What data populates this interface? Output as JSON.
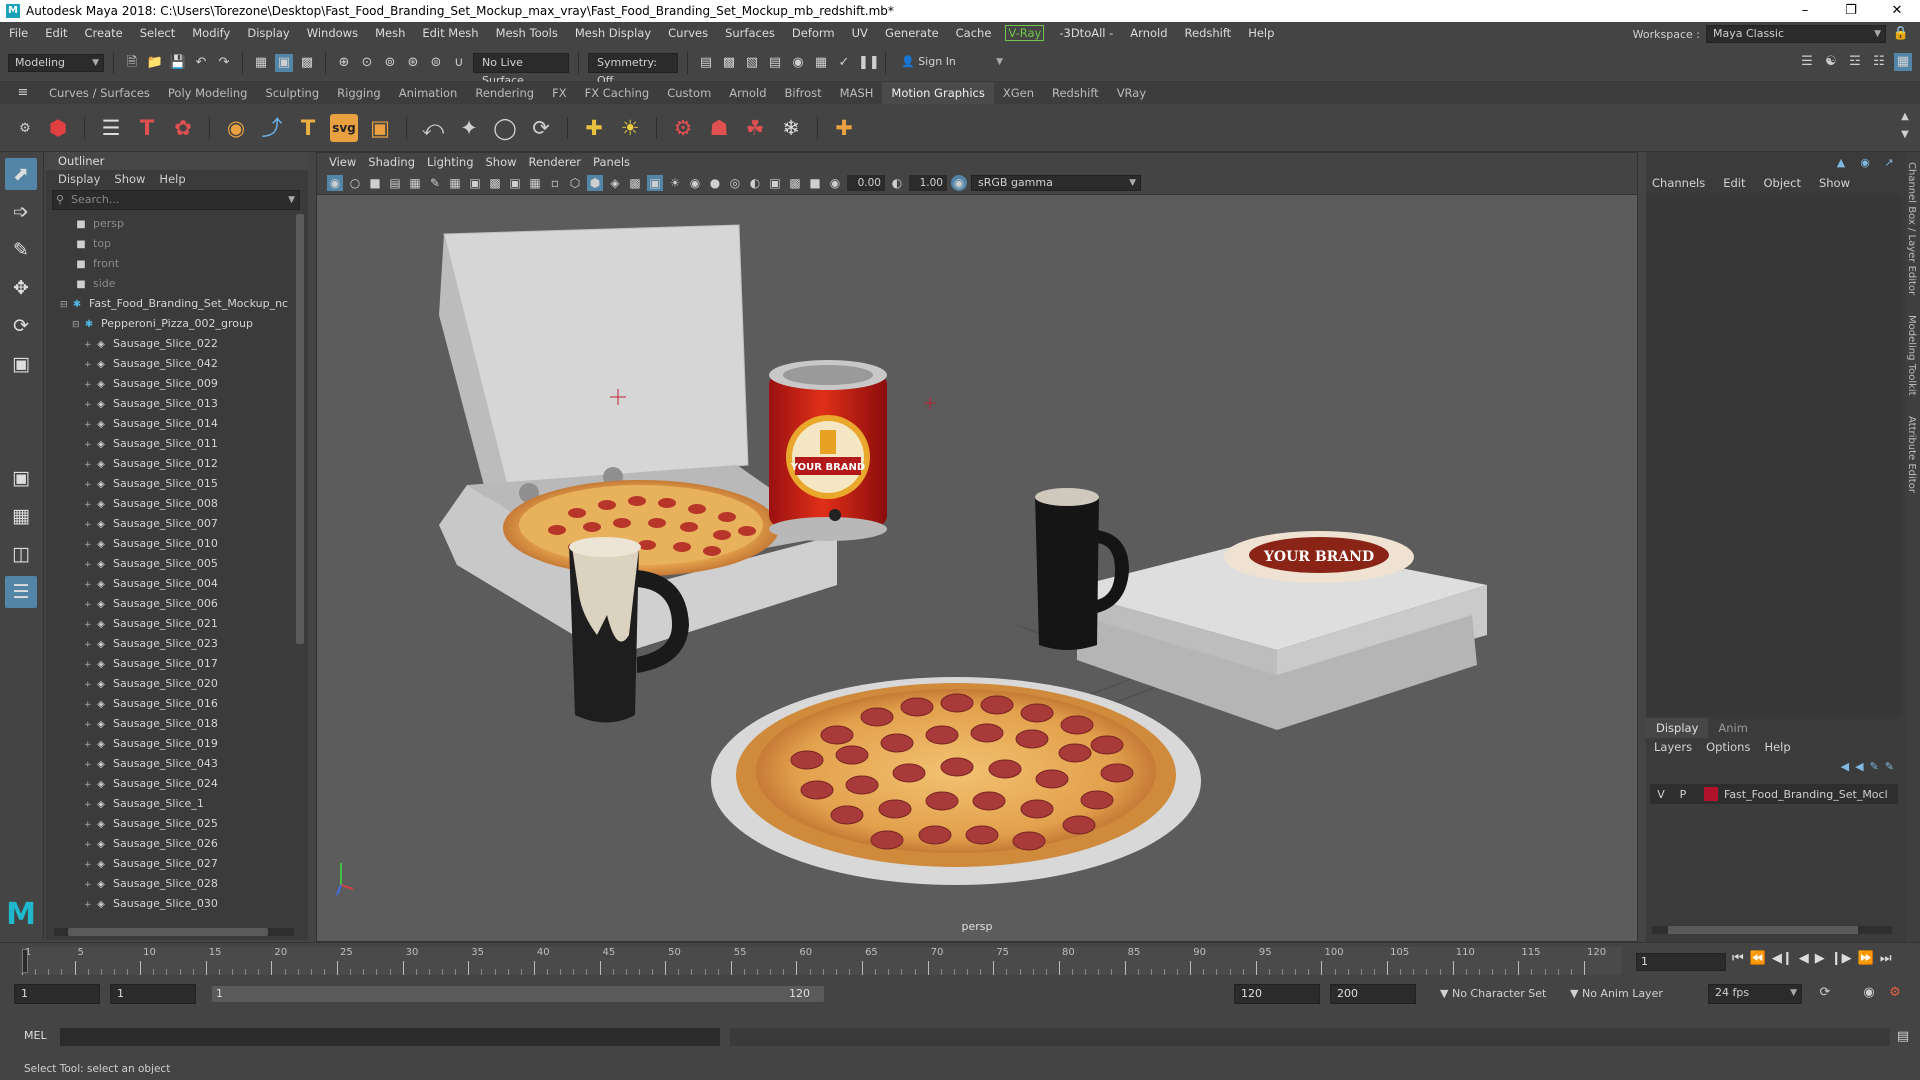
{
  "window": {
    "title": "Autodesk Maya 2018: C:\\Users\\Torezone\\Desktop\\Fast_Food_Branding_Set_Mockup_max_vray\\Fast_Food_Branding_Set_Mockup_mb_redshift.mb*",
    "app_icon": "M"
  },
  "menubar": {
    "items": [
      "File",
      "Edit",
      "Create",
      "Select",
      "Modify",
      "Display",
      "Windows",
      "Mesh",
      "Edit Mesh",
      "Mesh Tools",
      "Mesh Display",
      "Curves",
      "Surfaces",
      "Deform",
      "UV",
      "Generate",
      "Cache",
      "V-Ray",
      "-3DtoAll -",
      "Arnold",
      "Redshift",
      "Help"
    ],
    "workspace_label": "Workspace :",
    "workspace_value": "Maya Classic"
  },
  "statusline": {
    "mode": "Modeling",
    "live_surface": "No Live Surface",
    "symmetry": "Symmetry: Off",
    "sign_in": "Sign In"
  },
  "shelf": {
    "tabs": [
      "Curves / Surfaces",
      "Poly Modeling",
      "Sculpting",
      "Rigging",
      "Animation",
      "Rendering",
      "FX",
      "FX Caching",
      "Custom",
      "Arnold",
      "Bifrost",
      "MASH",
      "Motion Graphics",
      "XGen",
      "Redshift",
      "VRay"
    ],
    "active_tab": "Motion Graphics"
  },
  "outliner": {
    "title": "Outliner",
    "menu": [
      "Display",
      "Show",
      "Help"
    ],
    "search_placeholder": "Search...",
    "cameras": [
      "persp",
      "top",
      "front",
      "side"
    ],
    "root": "Fast_Food_Branding_Set_Mockup_nc",
    "group": "Pepperoni_Pizza_002_group",
    "items": [
      "Sausage_Slice_022",
      "Sausage_Slice_042",
      "Sausage_Slice_009",
      "Sausage_Slice_013",
      "Sausage_Slice_014",
      "Sausage_Slice_011",
      "Sausage_Slice_012",
      "Sausage_Slice_015",
      "Sausage_Slice_008",
      "Sausage_Slice_007",
      "Sausage_Slice_010",
      "Sausage_Slice_005",
      "Sausage_Slice_004",
      "Sausage_Slice_006",
      "Sausage_Slice_021",
      "Sausage_Slice_023",
      "Sausage_Slice_017",
      "Sausage_Slice_020",
      "Sausage_Slice_016",
      "Sausage_Slice_018",
      "Sausage_Slice_019",
      "Sausage_Slice_043",
      "Sausage_Slice_024",
      "Sausage_Slice_1",
      "Sausage_Slice_025",
      "Sausage_Slice_026",
      "Sausage_Slice_027",
      "Sausage_Slice_028",
      "Sausage_Slice_030"
    ]
  },
  "viewport": {
    "menu": [
      "View",
      "Shading",
      "Lighting",
      "Show",
      "Renderer",
      "Panels"
    ],
    "exposure": "0.00",
    "gamma": "1.00",
    "color_space": "sRGB gamma",
    "camera": "persp",
    "can_brand_text": "YOUR BRAND",
    "box_brand_text": "YOUR BRAND"
  },
  "channelbox": {
    "menu": [
      "Channels",
      "Edit",
      "Object",
      "Show"
    ],
    "layer_tabs": [
      "Display",
      "Anim"
    ],
    "layer_menu": [
      "Layers",
      "Options",
      "Help"
    ],
    "layer": {
      "v": "V",
      "p": "P",
      "name": "Fast_Food_Branding_Set_Mocl",
      "color": "#b0122b"
    },
    "side_labels": [
      "Channel Box / Layer Editor",
      "Modeling Toolkit",
      "Attribute Editor"
    ]
  },
  "timeline": {
    "ticks": [
      "1",
      "5",
      "10",
      "15",
      "20",
      "25",
      "30",
      "35",
      "40",
      "45",
      "50",
      "55",
      "60",
      "65",
      "70",
      "75",
      "80",
      "85",
      "90",
      "95",
      "100",
      "105",
      "110",
      "115",
      "120"
    ],
    "current_frame": "1"
  },
  "range": {
    "start": "1",
    "playback_start": "1",
    "slider_start": "1",
    "slider_end": "120",
    "playback_end": "120",
    "end": "200",
    "character_set": "No Character Set",
    "anim_layer": "No Anim Layer",
    "fps": "24 fps"
  },
  "cmdline": {
    "label": "MEL"
  },
  "helpline": {
    "text": "Select Tool: select an object"
  }
}
